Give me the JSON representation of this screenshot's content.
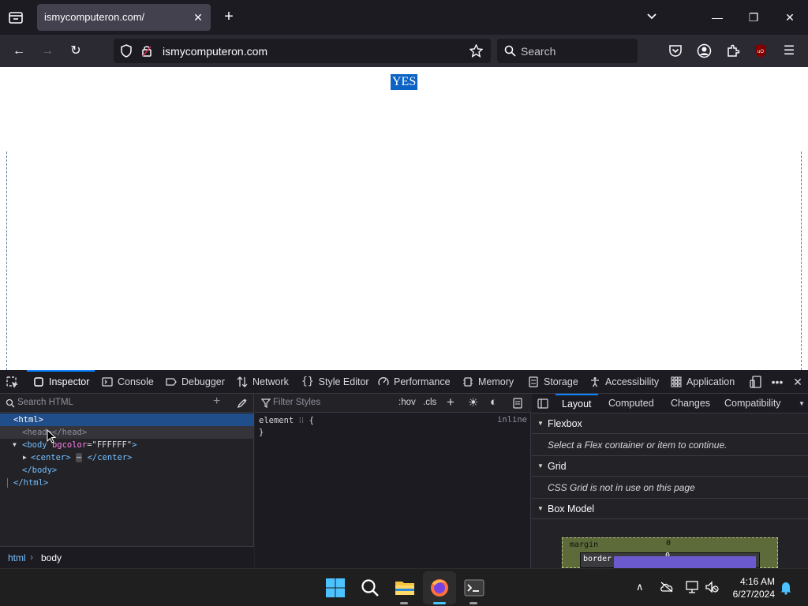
{
  "browser": {
    "tab_title": "ismycomputeron.com/",
    "url": "ismycomputeron.com",
    "search_placeholder": "Search"
  },
  "page": {
    "content_text": "YES"
  },
  "devtools": {
    "tools": [
      {
        "label": "Inspector"
      },
      {
        "label": "Console"
      },
      {
        "label": "Debugger"
      },
      {
        "label": "Network"
      },
      {
        "label": "Style Editor"
      },
      {
        "label": "Performance"
      },
      {
        "label": "Memory"
      },
      {
        "label": "Storage"
      },
      {
        "label": "Accessibility"
      },
      {
        "label": "Application"
      }
    ],
    "search_html_placeholder": "Search HTML",
    "tree": {
      "html_open": "<html>",
      "head": "<head></head>",
      "body_tag_open": "<body ",
      "body_attr_name": "bgcolor",
      "body_attr_eq": "=",
      "body_attr_value": "\"FFFFFF\"",
      "body_tag_close": ">",
      "center_open": "<center>",
      "center_ellipsis": "⋯",
      "center_close": "</center>",
      "body_close": "</body>",
      "html_close": "</html>"
    },
    "breadcrumb": [
      "html",
      "body"
    ],
    "filter_styles_placeholder": "Filter Styles",
    "hov": ":hov",
    "cls": ".cls",
    "rule_selector": "element",
    "rule_open": "{",
    "rule_close": "}",
    "rule_source": "inline",
    "right_tabs": [
      "Layout",
      "Computed",
      "Changes",
      "Compatibility"
    ],
    "flexbox_title": "Flexbox",
    "flexbox_msg": "Select a Flex container or item to continue.",
    "grid_title": "Grid",
    "grid_msg": "CSS Grid is not in use on this page",
    "boxmodel_title": "Box Model",
    "margin_label": "margin",
    "margin_value": "0",
    "border_label": "border",
    "border_value": "0"
  },
  "taskbar": {
    "time": "4:16 AM",
    "date": "6/27/2024"
  },
  "colors": {
    "accent": "#0a84ff",
    "selection": "#0b63c5"
  }
}
